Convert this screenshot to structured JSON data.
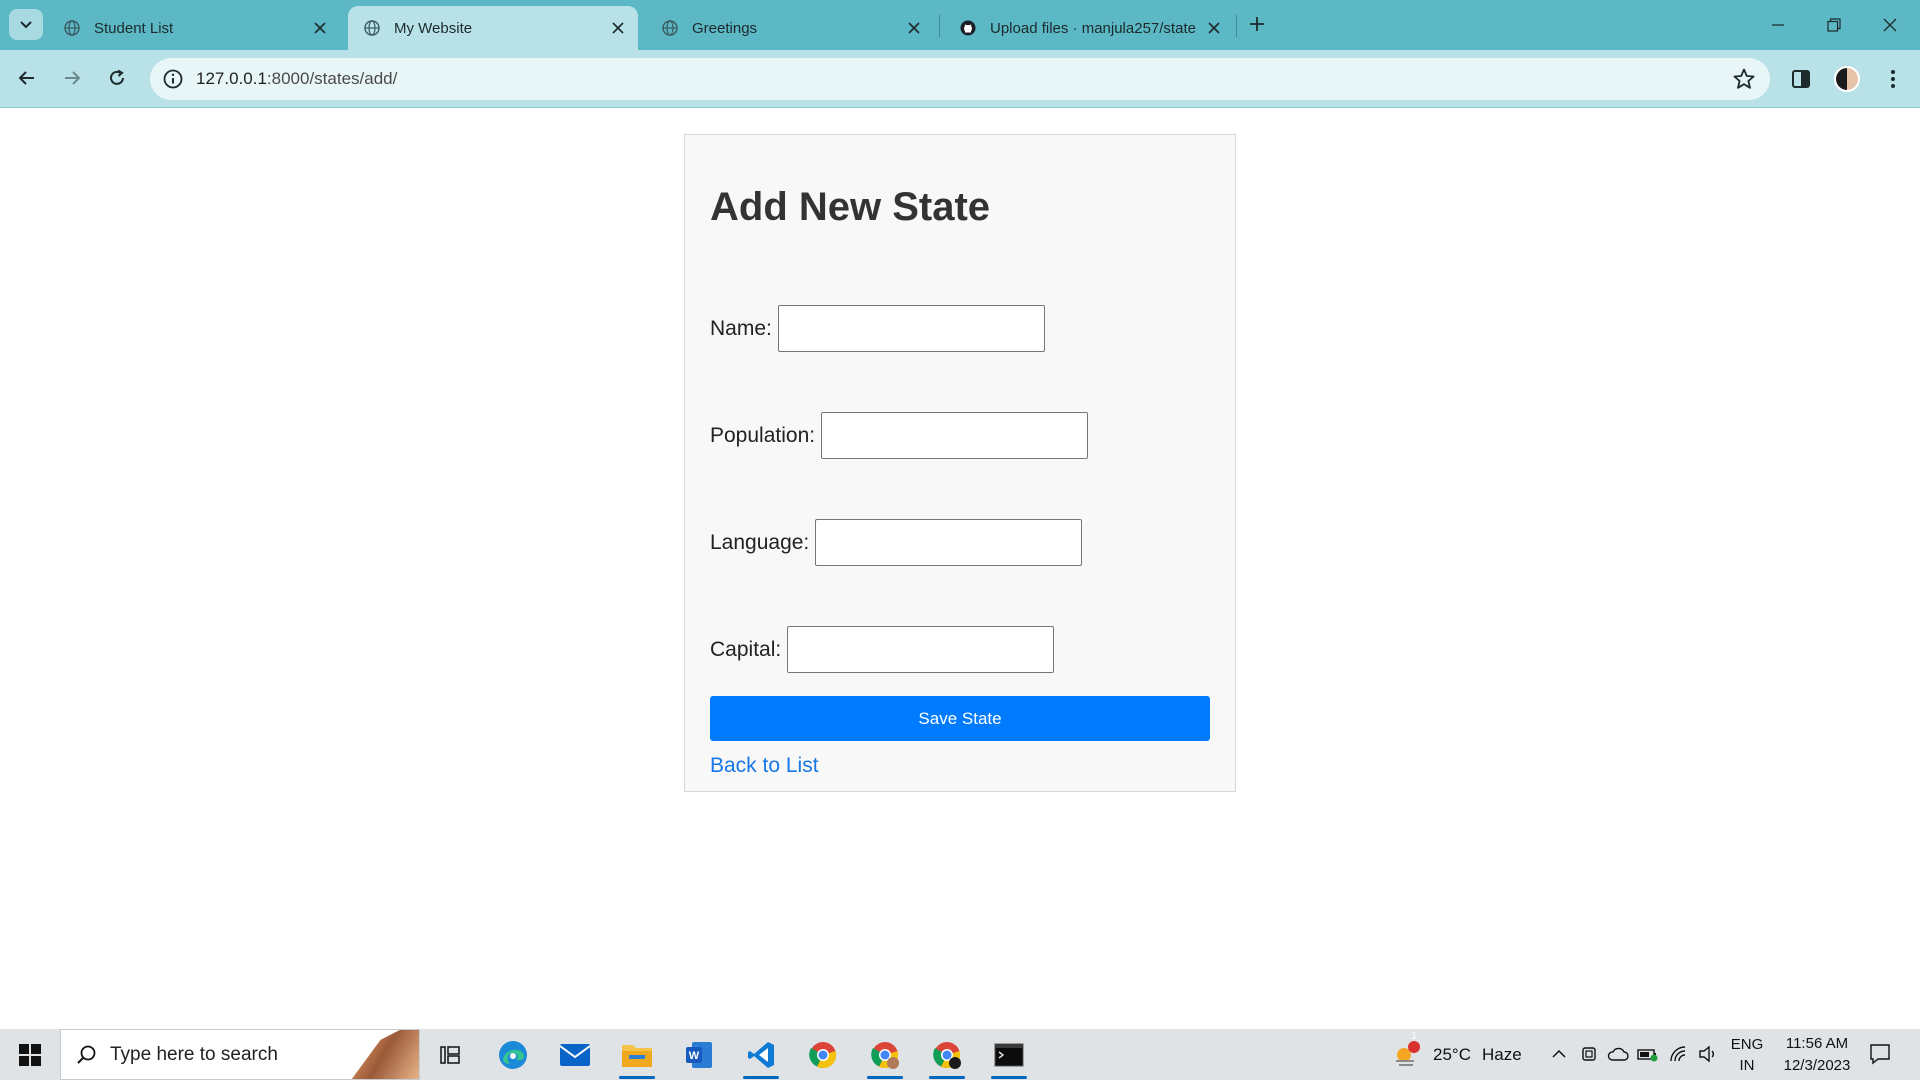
{
  "browser": {
    "tabs": [
      {
        "title": "Student List",
        "active": false
      },
      {
        "title": "My Website",
        "active": true
      },
      {
        "title": "Greetings",
        "active": false
      },
      {
        "title": "Upload files · manjula257/state",
        "active": false
      }
    ],
    "url_host": "127.0.0.1",
    "url_path": ":8000/states/add/"
  },
  "form": {
    "heading": "Add New State",
    "fields": [
      {
        "label": "Name:",
        "value": ""
      },
      {
        "label": "Population:",
        "value": ""
      },
      {
        "label": "Language:",
        "value": ""
      },
      {
        "label": "Capital:",
        "value": ""
      }
    ],
    "submit_label": "Save State",
    "back_link": "Back to List",
    "accent_color": "#007bff"
  },
  "taskbar": {
    "search_placeholder": "Type here to search",
    "weather_temp": "25°C",
    "weather_desc": "Haze",
    "weather_alert_count": "1",
    "lang_top": "ENG",
    "lang_bottom": "IN",
    "time": "11:56 AM",
    "date": "12/3/2023",
    "apps": [
      "task-view",
      "edge",
      "mail",
      "file-explorer",
      "word",
      "vscode",
      "chrome",
      "chrome-profile-2",
      "chrome-profile-3",
      "terminal"
    ]
  }
}
